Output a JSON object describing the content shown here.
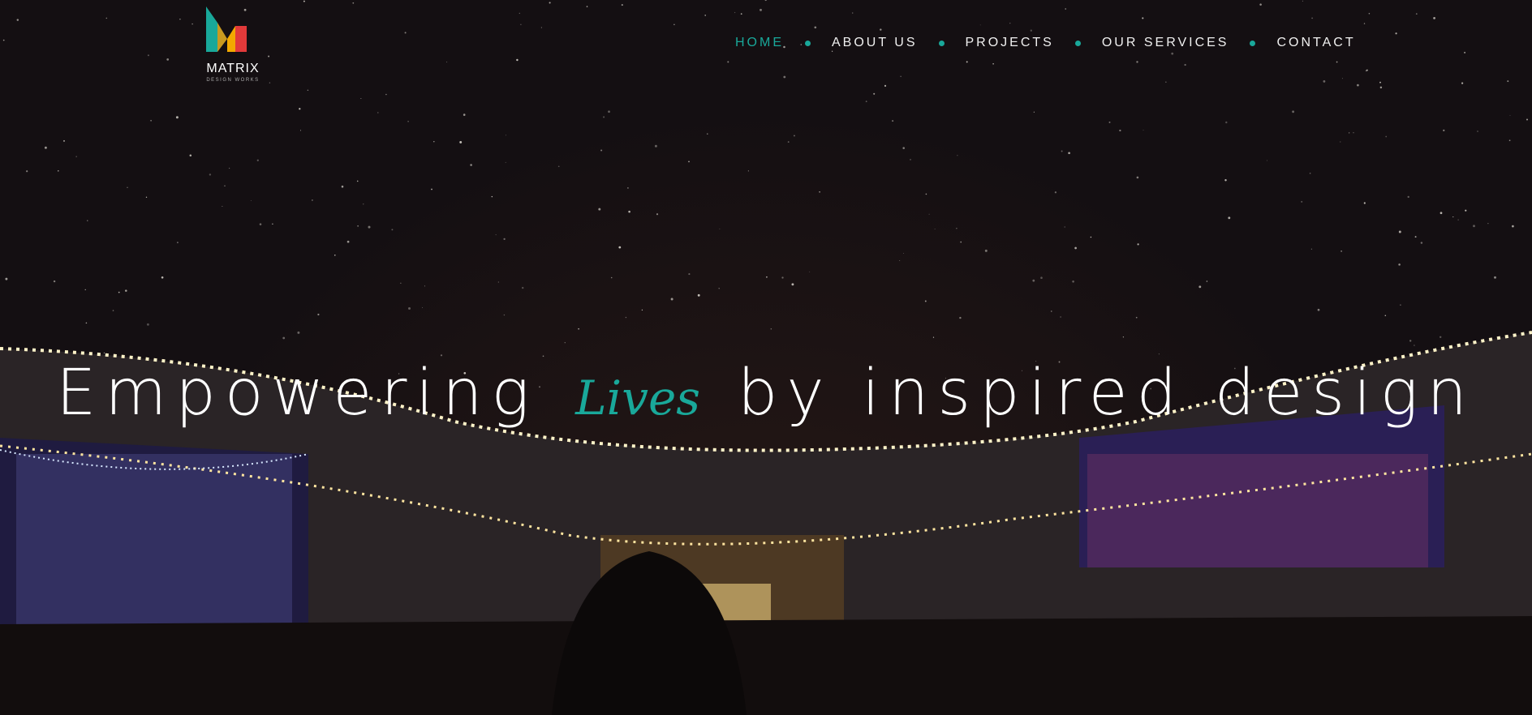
{
  "logo": {
    "name": "MATRIX",
    "tagline": "DESIGN WORKS"
  },
  "nav": {
    "items": [
      {
        "label": "HOME",
        "active": true
      },
      {
        "label": "ABOUT US",
        "active": false
      },
      {
        "label": "PROJECTS",
        "active": false
      },
      {
        "label": "OUR SERVICES",
        "active": false
      },
      {
        "label": "CONTACT",
        "active": false
      }
    ]
  },
  "hero": {
    "headline_before": "Empowering",
    "headline_script": "Lives",
    "headline_after": "by inspired design",
    "background": "night-lit shopping mall building with string lights under a starry sky"
  },
  "colors": {
    "accent": "#19a89a",
    "background": "#140f12",
    "text": "#ffffff"
  },
  "icons": {
    "logo": "matrix-m-logo-icon",
    "separator": "dot-separator-icon"
  }
}
